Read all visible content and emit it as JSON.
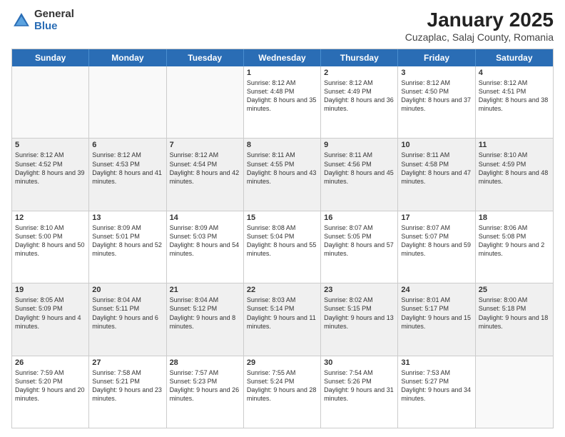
{
  "logo": {
    "general": "General",
    "blue": "Blue"
  },
  "title": "January 2025",
  "subtitle": "Cuzaplac, Salaj County, Romania",
  "days": [
    "Sunday",
    "Monday",
    "Tuesday",
    "Wednesday",
    "Thursday",
    "Friday",
    "Saturday"
  ],
  "weeks": [
    [
      {
        "day": "",
        "text": "",
        "empty": true
      },
      {
        "day": "",
        "text": "",
        "empty": true
      },
      {
        "day": "",
        "text": "",
        "empty": true
      },
      {
        "day": "1",
        "text": "Sunrise: 8:12 AM\nSunset: 4:48 PM\nDaylight: 8 hours\nand 35 minutes.",
        "empty": false
      },
      {
        "day": "2",
        "text": "Sunrise: 8:12 AM\nSunset: 4:49 PM\nDaylight: 8 hours\nand 36 minutes.",
        "empty": false
      },
      {
        "day": "3",
        "text": "Sunrise: 8:12 AM\nSunset: 4:50 PM\nDaylight: 8 hours\nand 37 minutes.",
        "empty": false
      },
      {
        "day": "4",
        "text": "Sunrise: 8:12 AM\nSunset: 4:51 PM\nDaylight: 8 hours\nand 38 minutes.",
        "empty": false
      }
    ],
    [
      {
        "day": "5",
        "text": "Sunrise: 8:12 AM\nSunset: 4:52 PM\nDaylight: 8 hours\nand 39 minutes.",
        "empty": false
      },
      {
        "day": "6",
        "text": "Sunrise: 8:12 AM\nSunset: 4:53 PM\nDaylight: 8 hours\nand 41 minutes.",
        "empty": false
      },
      {
        "day": "7",
        "text": "Sunrise: 8:12 AM\nSunset: 4:54 PM\nDaylight: 8 hours\nand 42 minutes.",
        "empty": false
      },
      {
        "day": "8",
        "text": "Sunrise: 8:11 AM\nSunset: 4:55 PM\nDaylight: 8 hours\nand 43 minutes.",
        "empty": false
      },
      {
        "day": "9",
        "text": "Sunrise: 8:11 AM\nSunset: 4:56 PM\nDaylight: 8 hours\nand 45 minutes.",
        "empty": false
      },
      {
        "day": "10",
        "text": "Sunrise: 8:11 AM\nSunset: 4:58 PM\nDaylight: 8 hours\nand 47 minutes.",
        "empty": false
      },
      {
        "day": "11",
        "text": "Sunrise: 8:10 AM\nSunset: 4:59 PM\nDaylight: 8 hours\nand 48 minutes.",
        "empty": false
      }
    ],
    [
      {
        "day": "12",
        "text": "Sunrise: 8:10 AM\nSunset: 5:00 PM\nDaylight: 8 hours\nand 50 minutes.",
        "empty": false
      },
      {
        "day": "13",
        "text": "Sunrise: 8:09 AM\nSunset: 5:01 PM\nDaylight: 8 hours\nand 52 minutes.",
        "empty": false
      },
      {
        "day": "14",
        "text": "Sunrise: 8:09 AM\nSunset: 5:03 PM\nDaylight: 8 hours\nand 54 minutes.",
        "empty": false
      },
      {
        "day": "15",
        "text": "Sunrise: 8:08 AM\nSunset: 5:04 PM\nDaylight: 8 hours\nand 55 minutes.",
        "empty": false
      },
      {
        "day": "16",
        "text": "Sunrise: 8:07 AM\nSunset: 5:05 PM\nDaylight: 8 hours\nand 57 minutes.",
        "empty": false
      },
      {
        "day": "17",
        "text": "Sunrise: 8:07 AM\nSunset: 5:07 PM\nDaylight: 8 hours\nand 59 minutes.",
        "empty": false
      },
      {
        "day": "18",
        "text": "Sunrise: 8:06 AM\nSunset: 5:08 PM\nDaylight: 9 hours\nand 2 minutes.",
        "empty": false
      }
    ],
    [
      {
        "day": "19",
        "text": "Sunrise: 8:05 AM\nSunset: 5:09 PM\nDaylight: 9 hours\nand 4 minutes.",
        "empty": false
      },
      {
        "day": "20",
        "text": "Sunrise: 8:04 AM\nSunset: 5:11 PM\nDaylight: 9 hours\nand 6 minutes.",
        "empty": false
      },
      {
        "day": "21",
        "text": "Sunrise: 8:04 AM\nSunset: 5:12 PM\nDaylight: 9 hours\nand 8 minutes.",
        "empty": false
      },
      {
        "day": "22",
        "text": "Sunrise: 8:03 AM\nSunset: 5:14 PM\nDaylight: 9 hours\nand 11 minutes.",
        "empty": false
      },
      {
        "day": "23",
        "text": "Sunrise: 8:02 AM\nSunset: 5:15 PM\nDaylight: 9 hours\nand 13 minutes.",
        "empty": false
      },
      {
        "day": "24",
        "text": "Sunrise: 8:01 AM\nSunset: 5:17 PM\nDaylight: 9 hours\nand 15 minutes.",
        "empty": false
      },
      {
        "day": "25",
        "text": "Sunrise: 8:00 AM\nSunset: 5:18 PM\nDaylight: 9 hours\nand 18 minutes.",
        "empty": false
      }
    ],
    [
      {
        "day": "26",
        "text": "Sunrise: 7:59 AM\nSunset: 5:20 PM\nDaylight: 9 hours\nand 20 minutes.",
        "empty": false
      },
      {
        "day": "27",
        "text": "Sunrise: 7:58 AM\nSunset: 5:21 PM\nDaylight: 9 hours\nand 23 minutes.",
        "empty": false
      },
      {
        "day": "28",
        "text": "Sunrise: 7:57 AM\nSunset: 5:23 PM\nDaylight: 9 hours\nand 26 minutes.",
        "empty": false
      },
      {
        "day": "29",
        "text": "Sunrise: 7:55 AM\nSunset: 5:24 PM\nDaylight: 9 hours\nand 28 minutes.",
        "empty": false
      },
      {
        "day": "30",
        "text": "Sunrise: 7:54 AM\nSunset: 5:26 PM\nDaylight: 9 hours\nand 31 minutes.",
        "empty": false
      },
      {
        "day": "31",
        "text": "Sunrise: 7:53 AM\nSunset: 5:27 PM\nDaylight: 9 hours\nand 34 minutes.",
        "empty": false
      },
      {
        "day": "",
        "text": "",
        "empty": true
      }
    ]
  ]
}
